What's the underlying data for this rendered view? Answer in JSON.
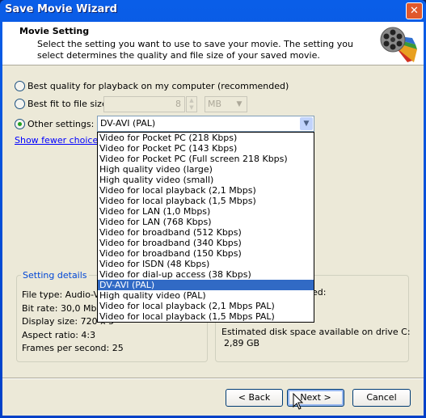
{
  "window": {
    "title": "Save Movie Wizard"
  },
  "header": {
    "title": "Movie Setting",
    "description": "Select the setting you want to use to save your movie. The setting you select determines the quality and file size of your saved movie."
  },
  "options": {
    "best_quality": "Best quality for playback on my computer (recommended)",
    "best_fit": "Best fit to file size:",
    "file_size_value": "8",
    "file_size_unit": "MB",
    "other": "Other settings:",
    "selected": "DV-AVI (PAL)",
    "show_fewer": "Show fewer choices..."
  },
  "dropdown": {
    "items": [
      "Video for Pocket PC (218 Kbps)",
      "Video for Pocket PC (143 Kbps)",
      "Video for Pocket PC (Full screen 218 Kbps)",
      "High quality video (large)",
      "High quality video (small)",
      "Video for local playback (2,1 Mbps)",
      "Video for local playback (1,5 Mbps)",
      "Video for LAN (1,0 Mbps)",
      "Video for LAN (768 Kbps)",
      "Video for broadband (512 Kbps)",
      "Video for broadband (340 Kbps)",
      "Video for broadband (150 Kbps)",
      "Video for ISDN (48 Kbps)",
      "Video for dial-up access (38 Kbps)",
      "DV-AVI (PAL)",
      "High quality video (PAL)",
      "Video for local playback (2,1 Mbps PAL)",
      "Video for local playback (1,5 Mbps PAL)"
    ],
    "selected_index": 14
  },
  "details": {
    "label": "Setting details",
    "lines": [
      "File type: Audio-Vid",
      "Bit rate: 30,0 Mbps",
      "Display size: 720 x 5",
      "Aspect ratio: 4:3",
      "Frames per second: 25"
    ]
  },
  "size": {
    "partial": "ed:",
    "disk_label": "Estimated disk space available on drive C:",
    "disk_value": "2,89 GB"
  },
  "buttons": {
    "back": "< Back",
    "next": "Next >",
    "cancel": "Cancel"
  },
  "colors": {
    "titlebar": "#0a5ee8",
    "selection": "#316ac5",
    "dialog": "#ece9d8"
  }
}
